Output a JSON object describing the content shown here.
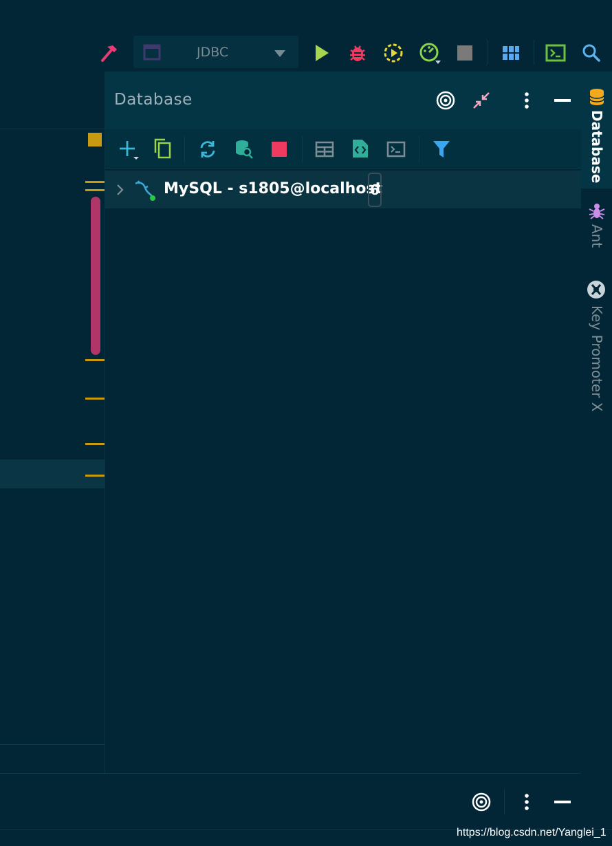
{
  "toolbar": {
    "run_config": "JDBC",
    "icons": [
      "hammer-icon",
      "window-icon",
      "dropdown-arrow-icon",
      "run-icon",
      "debug-icon",
      "coverage-icon",
      "profiler-icon",
      "stop-icon",
      "layout-icon",
      "terminal-icon",
      "search-icon"
    ],
    "colors": {
      "run": "#a5d64d",
      "debug": "#f03a5f",
      "coverage": "#e5d83a",
      "profiler": "#8bd34a",
      "hammer": "#ea3c74",
      "stop": "#7a7a7a",
      "grid": "#5aa9f0",
      "terminal": "#6ec240",
      "search": "#5ab4f0"
    }
  },
  "panel": {
    "title": "Database",
    "header_icons": [
      "target-icon",
      "collapse-icon",
      "more-icon",
      "minimize-icon"
    ],
    "toolbar_icons": [
      "add-icon",
      "copy-icon",
      "refresh-icon",
      "schema-search-icon",
      "stop-icon",
      "table-icon",
      "ddl-icon",
      "console-icon",
      "filter-icon"
    ]
  },
  "tree": {
    "items": [
      {
        "label": "MySQL - s1805@localhost",
        "count": "6"
      }
    ]
  },
  "sidebar": {
    "tabs": [
      {
        "label": "Database",
        "icon": "database-icon",
        "active": true
      },
      {
        "label": "Ant",
        "icon": "ant-icon",
        "active": false
      },
      {
        "label": "Key Promoter X",
        "icon": "key-promoter-icon",
        "active": false
      }
    ]
  },
  "bottom": {
    "icons": [
      "target-icon",
      "more-icon",
      "minimize-icon"
    ]
  },
  "watermark": "https://blog.csdn.net/Yanglei_1"
}
